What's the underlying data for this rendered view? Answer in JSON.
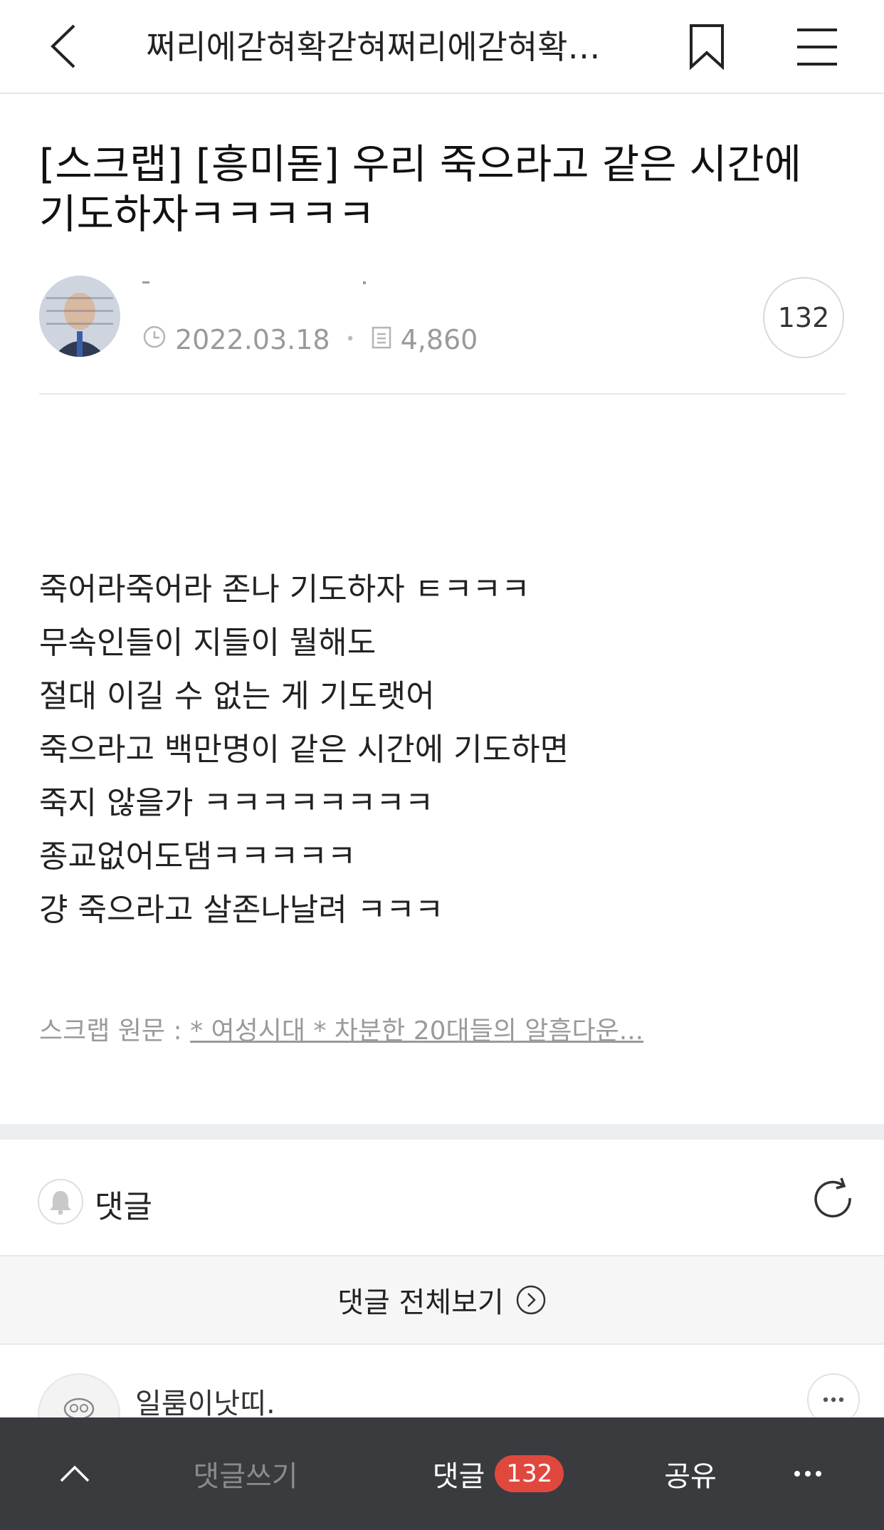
{
  "header": {
    "cafe_title": "쩌리에갇혀확갇혀쩌리에갇혀확…"
  },
  "post": {
    "title": "[스크랩] [흥미돋] 우리 죽으라고 같은 시간에 기도하자ㅋㅋㅋㅋㅋ",
    "date": "2022.03.18",
    "views": "4,860",
    "comment_count": "132",
    "body_lines": [
      "죽어라죽어라 존나 기도하자 ㅌㅋㅋㅋ",
      "무속인들이 지들이 뭘해도",
      "절대 이길 수 없는 게 기도랫어",
      "죽으라고 백만명이 같은 시간에 기도하면",
      "죽지 않을가 ㅋㅋㅋㅋㅋㅋㅋㅋ",
      "종교없어도댐ㅋㅋㅋㅋㅋ",
      "걍 죽으라고 살존나날려 ㅋㅋㅋ"
    ],
    "scrap_label": "스크랩 원문 :",
    "scrap_link": "* 여성시대 *  차분한 20대들의 알흠다운..."
  },
  "comments": {
    "label": "댓글",
    "view_all": "댓글 전체보기",
    "first_comment_author": "일룸이낫띠."
  },
  "bottom_bar": {
    "write": "댓글쓰기",
    "comments": "댓글",
    "comments_badge": "132",
    "share": "공유"
  },
  "icons": {
    "back": "chevron-left-icon",
    "bookmark": "bookmark-icon",
    "menu": "hamburger-icon",
    "clock": "clock-icon",
    "views": "document-icon",
    "bell": "bell-icon",
    "refresh": "refresh-icon",
    "arrow": "chevron-right-circle-icon",
    "up": "chevron-up-icon",
    "more": "more-dots-icon"
  },
  "colors": {
    "badge": "#e0483e",
    "bottom_bar": "#3a3b3f"
  }
}
